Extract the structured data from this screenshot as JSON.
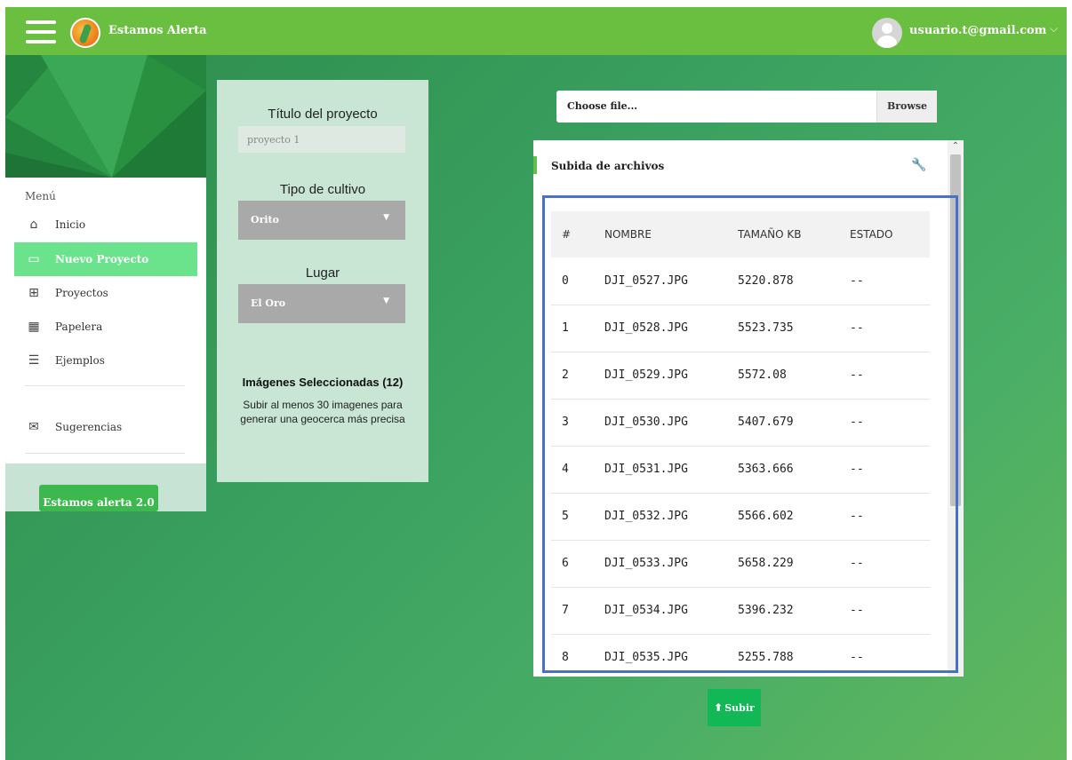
{
  "topbar": {
    "brand": "Estamos Alerta",
    "user_email": "usuario.t@gmail.com",
    "chevron": "⌵"
  },
  "sidebar": {
    "menu_title": "Menú",
    "items": [
      {
        "label": "Inicio",
        "icon": "⌂"
      },
      {
        "label": "Nuevo Proyecto",
        "icon": "▭"
      },
      {
        "label": "Proyectos",
        "icon": "⊞"
      },
      {
        "label": "Papelera",
        "icon": "▦"
      },
      {
        "label": "Ejemplos",
        "icon": "☰"
      },
      {
        "label": "Sugerencias",
        "icon": "✉"
      }
    ],
    "cta_label": "Estamos alerta 2.0"
  },
  "form": {
    "title_label": "Título del proyecto",
    "title_value": "proyecto 1",
    "crop_label": "Tipo de cultivo",
    "crop_value": "Orito",
    "place_label": "Lugar",
    "place_value": "El Oro",
    "caret": "▼",
    "selected_heading": "Imágenes Seleccionadas (12)",
    "note": "Subir al menos 30 imagenes para generar una geocerca más precisa"
  },
  "file_chooser": {
    "placeholder": "Choose file...",
    "browse_label": "Browse"
  },
  "upload": {
    "title": "Subida de archivos",
    "wrench": "🔧",
    "scroll_up": "⌃",
    "columns": [
      "#",
      "NOMBRE",
      "TAMAÑO KB",
      "ESTADO"
    ],
    "rows": [
      [
        "0",
        "DJI_0527.JPG",
        "5220.878",
        "--"
      ],
      [
        "1",
        "DJI_0528.JPG",
        "5523.735",
        "--"
      ],
      [
        "2",
        "DJI_0529.JPG",
        "5572.08",
        "--"
      ],
      [
        "3",
        "DJI_0530.JPG",
        "5407.679",
        "--"
      ],
      [
        "4",
        "DJI_0531.JPG",
        "5363.666",
        "--"
      ],
      [
        "5",
        "DJI_0532.JPG",
        "5566.602",
        "--"
      ],
      [
        "6",
        "DJI_0533.JPG",
        "5658.229",
        "--"
      ],
      [
        "7",
        "DJI_0534.JPG",
        "5396.232",
        "--"
      ],
      [
        "8",
        "DJI_0535.JPG",
        "5255.788",
        "--"
      ]
    ],
    "submit_label": "Subir",
    "submit_icon": "⬆"
  }
}
